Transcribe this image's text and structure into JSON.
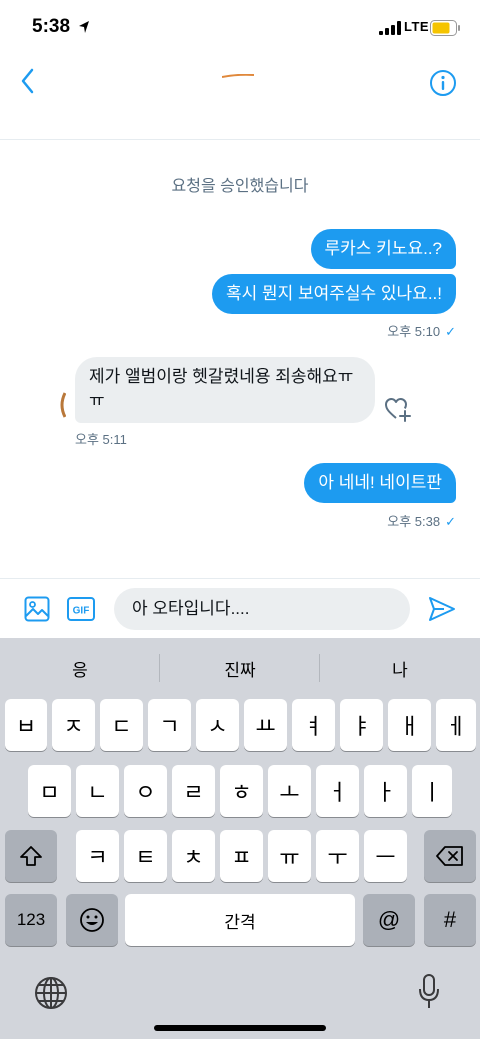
{
  "status_bar": {
    "time": "5:38",
    "network": "LTE"
  },
  "system_note": "요청을 승인했습니다",
  "messages": [
    {
      "text": "루카스 키노요..?"
    },
    {
      "text": "혹시 뭔지 보여주실수 있나요..!"
    },
    {
      "text": "제가 앨범이랑 헷갈렸네용 죄송해요ㅠㅠ"
    },
    {
      "text": "아 네네! 네이트판"
    }
  ],
  "meta": {
    "out1": "오후 5:10",
    "in1": "오후 5:11",
    "out2": "오후 5:38",
    "check": "✓"
  },
  "composer": {
    "value": "아 오타입니다...."
  },
  "keyboard": {
    "suggestions": [
      "응",
      "진짜",
      "나"
    ],
    "row1": [
      "ㅂ",
      "ㅈ",
      "ㄷ",
      "ㄱ",
      "ㅅ",
      "ㅛ",
      "ㅕ",
      "ㅑ",
      "ㅐ",
      "ㅔ"
    ],
    "row2": [
      "ㅁ",
      "ㄴ",
      "ㅇ",
      "ㄹ",
      "ㅎ",
      "ㅗ",
      "ㅓ",
      "ㅏ",
      "ㅣ"
    ],
    "row3": [
      "ㅋ",
      "ㅌ",
      "ㅊ",
      "ㅍ",
      "ㅠ",
      "ㅜ",
      "ㅡ"
    ],
    "numbers_key": "123",
    "space_key": "간격",
    "at_key": "@",
    "hash_key": "#"
  },
  "colors": {
    "accent": "#1d9bf0",
    "incoming_bubble": "#ebeef0",
    "keyboard_bg": "#d2d5db"
  }
}
